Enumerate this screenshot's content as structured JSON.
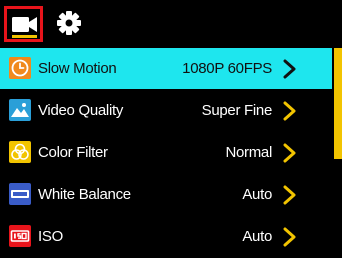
{
  "tabs": [
    {
      "name": "camera-icon",
      "active": true
    },
    {
      "name": "gear-icon",
      "active": false
    }
  ],
  "colors": {
    "selected_row": "#1ee6ee",
    "accent_yellow": "#f2c400",
    "active_tab_border": "#e8141b",
    "background": "#000000"
  },
  "menu": {
    "items": [
      {
        "label": "Slow Motion",
        "value": "1080P 60FPS",
        "icon": "slow-motion-icon",
        "selected": true
      },
      {
        "label": "Video Quality",
        "value": "Super Fine",
        "icon": "video-quality-icon",
        "selected": false
      },
      {
        "label": "Color Filter",
        "value": "Normal",
        "icon": "color-filter-icon",
        "selected": false
      },
      {
        "label": "White Balance",
        "value": "Auto",
        "icon": "white-balance-icon",
        "selected": false
      },
      {
        "label": "ISO",
        "value": "Auto",
        "icon": "iso-icon",
        "selected": false
      }
    ]
  }
}
